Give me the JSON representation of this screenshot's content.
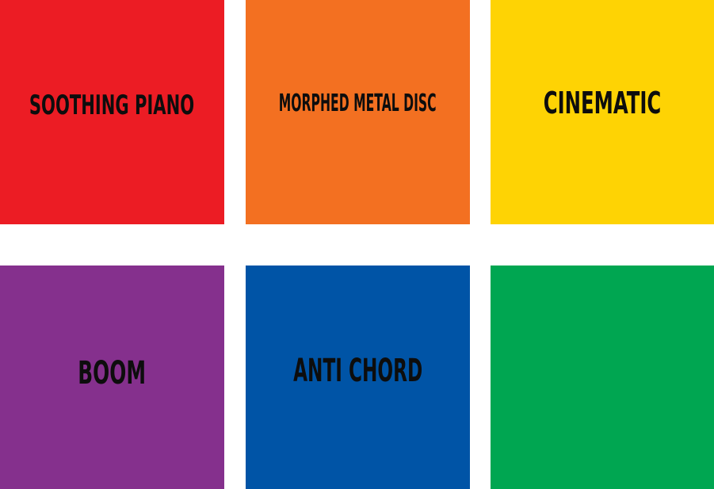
{
  "sound_grid": {
    "tiles": [
      {
        "label": "SOOTHING PIANO",
        "color": "#ec1c24"
      },
      {
        "label": "MORPHED METAL DISC",
        "color": "#f37021"
      },
      {
        "label": "CINEMATIC",
        "color": "#fed304"
      },
      {
        "label": "BOOM",
        "color": "#85308d"
      },
      {
        "label": "ANTI CHORD",
        "color": "#0054a6"
      },
      {
        "label": "",
        "color": "#00a651"
      }
    ]
  }
}
